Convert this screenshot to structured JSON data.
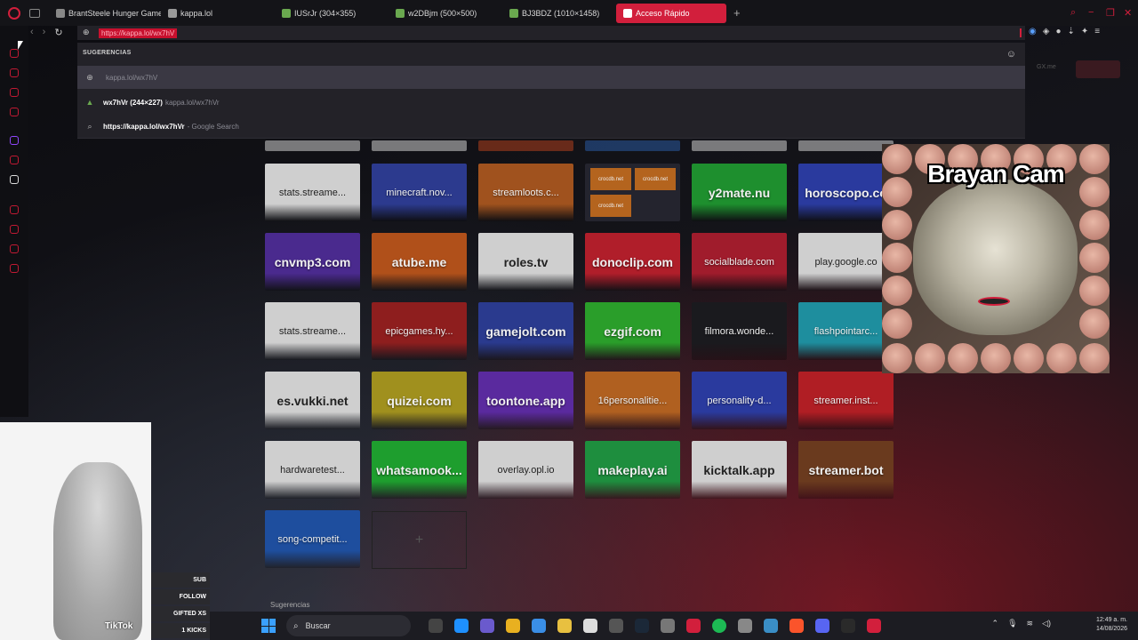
{
  "tabs": [
    {
      "label": "BrantSteele Hunger Game",
      "fav_color": "#888888"
    },
    {
      "label": "kappa.lol",
      "fav_color": "#999999"
    },
    {
      "label": "IUSrJr (304×355)",
      "fav_color": "#6aa84f"
    },
    {
      "label": "w2DBjm (500×500)",
      "fav_color": "#6aa84f"
    },
    {
      "label": "BJ3BDZ (1010×1458)",
      "fav_color": "#6aa84f"
    },
    {
      "label": "Acceso Rápido",
      "fav_color": "#ffffff"
    }
  ],
  "address": {
    "url": "https://kappa.lol/wx7hV"
  },
  "dropdown": {
    "title": "SUGERENCIAS",
    "items": [
      {
        "icon": "⊕",
        "main": "",
        "sub": "kappa.lol/wx7hV"
      },
      {
        "icon": "▲",
        "main": "wx7hVr (244×227)",
        "sub": "kappa.lol/wx7hVr"
      },
      {
        "icon": "⌕",
        "main": "https://kappa.lol/wx7hVr",
        "sub": " - Google Search"
      }
    ]
  },
  "tiles": [
    {
      "label": "stats.streame...",
      "color": "#cfcfcf",
      "text": "dark"
    },
    {
      "label": "minecraft.nov...",
      "color": "#2c3a8e",
      "text": "light"
    },
    {
      "label": "streamloots.c...",
      "color": "#a0521e",
      "text": "light"
    },
    {
      "label": "",
      "color": "#2a2a36",
      "text": "light"
    },
    {
      "label": "y2mate.nu",
      "color": "#1e8f2e",
      "text": "light"
    },
    {
      "label": "horoscopo.co",
      "color": "#2a3a9e",
      "text": "light"
    },
    {
      "label": "cnvmp3.com",
      "color": "#4a2a8e",
      "text": "light"
    },
    {
      "label": "atube.me",
      "color": "#b0501a",
      "text": "light"
    },
    {
      "label": "roles.tv",
      "color": "#cfcfcf",
      "text": "dark"
    },
    {
      "label": "donoclip.com",
      "color": "#b01e2a",
      "text": "light"
    },
    {
      "label": "socialblade.com",
      "color": "#a01c2c",
      "text": "light"
    },
    {
      "label": "play.google.co",
      "color": "#cfcfcf",
      "text": "dark"
    },
    {
      "label": "stats.streame...",
      "color": "#cfcfcf",
      "text": "dark"
    },
    {
      "label": "epicgames.hy...",
      "color": "#8e1e1e",
      "text": "light"
    },
    {
      "label": "gamejolt.com",
      "color": "#2a3a8e",
      "text": "light"
    },
    {
      "label": "ezgif.com",
      "color": "#2a9e2a",
      "text": "light"
    },
    {
      "label": "filmora.wonde...",
      "color": "#1a1a1e",
      "text": "light"
    },
    {
      "label": "flashpointarc...",
      "color": "#1e8e9e",
      "text": "light"
    },
    {
      "label": "es.vukki.net",
      "color": "#cfcfcf",
      "text": "dark"
    },
    {
      "label": "quizei.com",
      "color": "#a0901e",
      "text": "light"
    },
    {
      "label": "toontone.app",
      "color": "#5a2a9e",
      "text": "light"
    },
    {
      "label": "16personalitie...",
      "color": "#b06020",
      "text": "light"
    },
    {
      "label": "personality-d...",
      "color": "#2a3a9e",
      "text": "light"
    },
    {
      "label": "streamer.inst...",
      "color": "#b01e24",
      "text": "light"
    },
    {
      "label": "hardwaretest...",
      "color": "#cfcfcf",
      "text": "dark"
    },
    {
      "label": "whatsamook...",
      "color": "#1e9e2e",
      "text": "light"
    },
    {
      "label": "overlay.opl.io",
      "color": "#cfcfcf",
      "text": "dark"
    },
    {
      "label": "makeplay.ai",
      "color": "#1e8e3e",
      "text": "light"
    },
    {
      "label": "kicktalk.app",
      "color": "#cfcfcf",
      "text": "dark"
    },
    {
      "label": "streamer.bot",
      "color": "#6a3a1e",
      "text": "light"
    },
    {
      "label": "song-competit...",
      "color": "#1e4e9e",
      "text": "light"
    }
  ],
  "crocodb": {
    "labels": [
      "crocdb.net",
      "crocdb.net",
      "crocdb.net"
    ]
  },
  "cam": {
    "title": "Brayan Cam"
  },
  "tiktok": {
    "label": "TikTok"
  },
  "stream_stats": [
    "SUB",
    "FOLLOW",
    "GIFTED XS",
    "1 KICKS"
  ],
  "sugerencias": "Sugerencias",
  "taskbar": {
    "search_placeholder": "Buscar",
    "time": "12:49 a. m.",
    "date": "14/08/2026"
  },
  "colors": {
    "accent": "#d21f3c",
    "opera_red": "#c8102e"
  }
}
